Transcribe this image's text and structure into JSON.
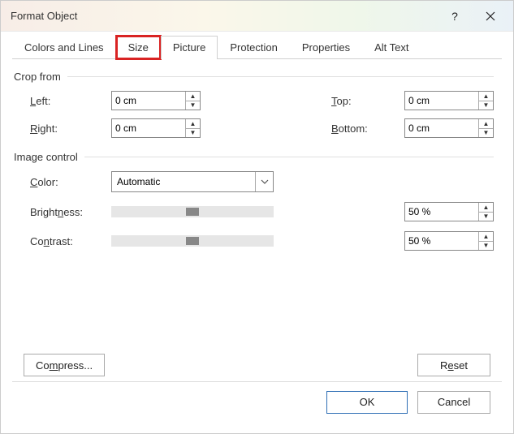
{
  "window": {
    "title": "Format Object"
  },
  "tabs": {
    "colors_lines": "Colors and Lines",
    "size": "Size",
    "picture": "Picture",
    "protection": "Protection",
    "properties": "Properties",
    "alt_text": "Alt Text"
  },
  "crop": {
    "heading": "Crop from",
    "left_label": "Left:",
    "left_value": "0 cm",
    "right_label": "Right:",
    "right_value": "0 cm",
    "top_label": "Top:",
    "top_value": "0 cm",
    "bottom_label": "Bottom:",
    "bottom_value": "0 cm"
  },
  "image": {
    "heading": "Image control",
    "color_label": "Color:",
    "color_value": "Automatic",
    "brightness_label": "Brightness:",
    "brightness_value": "50 %",
    "contrast_label": "Contrast:",
    "contrast_value": "50 %"
  },
  "buttons": {
    "compress": "Compress...",
    "reset": "Reset",
    "ok": "OK",
    "cancel": "Cancel"
  }
}
